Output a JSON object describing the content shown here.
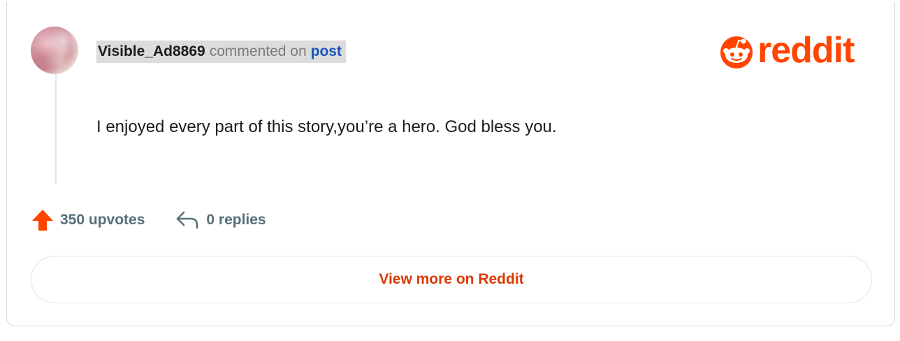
{
  "comment": {
    "username": "Visible_Ad8869",
    "action_text": "commented on",
    "post_link_label": "post",
    "body": "I enjoyed every part of this story,you’re a hero. God bless you.",
    "avatar": "user-avatar-pink-swirl"
  },
  "brand": {
    "wordmark": "reddit",
    "icon": "reddit-snoo-icon",
    "color": "#ff4500"
  },
  "stats": {
    "upvotes_label": "350 upvotes",
    "upvote_icon": "upvote-arrow-icon",
    "upvote_color": "#ff4500",
    "replies_label": "0 replies",
    "reply_icon": "reply-arrow-icon"
  },
  "cta": {
    "label": "View more on Reddit",
    "color": "#d93a00"
  }
}
